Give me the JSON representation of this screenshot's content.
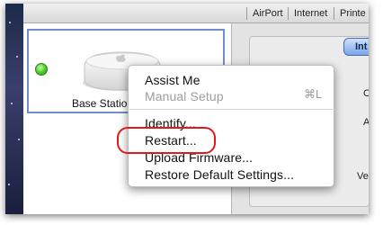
{
  "toolbar": {
    "items": [
      "AirPort",
      "Internet",
      "Printe"
    ]
  },
  "base_station": {
    "label": "Base Statio",
    "status_color": "#53d62e"
  },
  "right_panel": {
    "button_label": "Int",
    "edge_letters": [
      "C",
      "A",
      "Ve"
    ]
  },
  "context_menu": {
    "items": [
      {
        "label": "Assist Me",
        "enabled": true
      },
      {
        "label": "Manual Setup",
        "enabled": false,
        "shortcut": "⌘L"
      },
      {
        "label": "Identify...",
        "enabled": true
      },
      {
        "label": "Restart...",
        "enabled": true,
        "highlighted": true
      },
      {
        "label": "Upload Firmware...",
        "enabled": true
      },
      {
        "label": "Restore Default Settings...",
        "enabled": true
      }
    ]
  },
  "colors": {
    "selection_border": "#6e8fc8",
    "highlight_ring": "#e0191d",
    "button_blue": "#7aa6ea"
  }
}
